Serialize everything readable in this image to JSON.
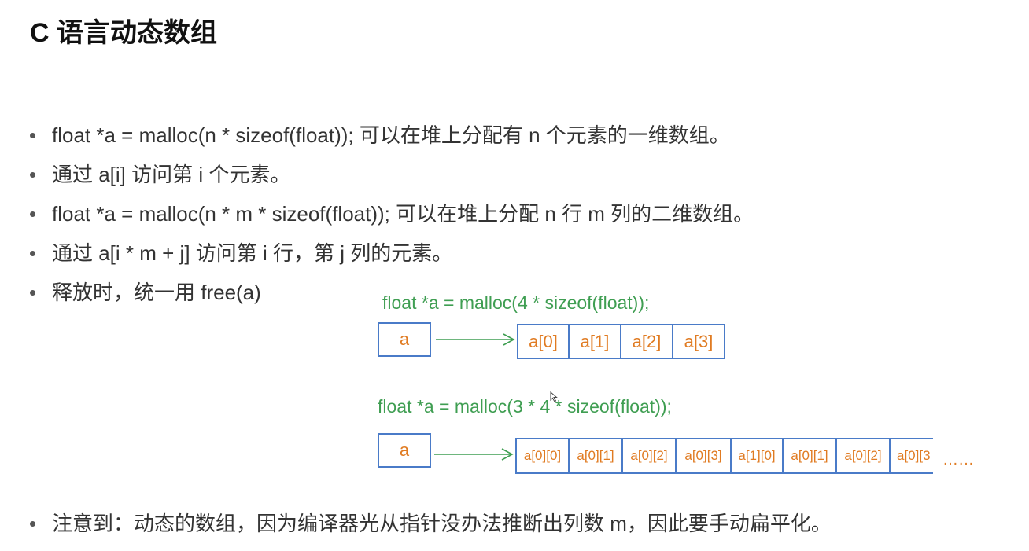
{
  "title": "C 语言动态数组",
  "bullets": [
    "float *a = malloc(n * sizeof(float)); 可以在堆上分配有 n 个元素的一维数组。",
    "通过 a[i] 访问第 i 个元素。",
    "float *a = malloc(n * m * sizeof(float)); 可以在堆上分配 n 行 m 列的二维数组。",
    "通过 a[i * m + j] 访问第 i 行，第 j 列的元素。",
    "释放时，统一用 free(a)"
  ],
  "note": "注意到：动态的数组，因为编译器光从指针没办法推断出列数 m，因此要手动扁平化。",
  "diagram1": {
    "code": "float *a = malloc(4 * sizeof(float));",
    "pointer": "a",
    "cells": [
      "a[0]",
      "a[1]",
      "a[2]",
      "a[3]"
    ]
  },
  "diagram2": {
    "code": "float *a = malloc(3 * 4 * sizeof(float));",
    "pointer": "a",
    "cells": [
      "a[0][0]",
      "a[0][1]",
      "a[0][2]",
      "a[0][3]",
      "a[1][0]",
      "a[0][1]",
      "a[0][2]",
      "a[0][3"
    ],
    "ellipsis": "……"
  },
  "colors": {
    "code": "#3f9e52",
    "box_border": "#4a7bc8",
    "box_text": "#e07b22",
    "arrow": "#3f9e52"
  }
}
